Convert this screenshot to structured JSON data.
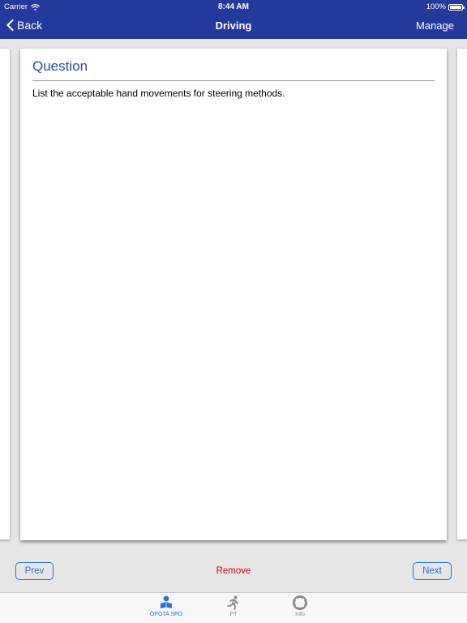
{
  "status_bar": {
    "carrier": "Carrier",
    "time": "8:44 AM",
    "battery": "100%"
  },
  "nav": {
    "back_label": "Back",
    "title": "Driving",
    "manage_label": "Manage"
  },
  "card": {
    "heading": "Question",
    "question_text": "List the acceptable hand movements for steering methods."
  },
  "toolbar": {
    "prev_label": "Prev",
    "remove_label": "Remove",
    "next_label": "Next"
  },
  "tabs": [
    {
      "label": "OPOTA SPO",
      "icon": "reader-icon",
      "active": true
    },
    {
      "label": "PT",
      "icon": "runner-icon",
      "active": false
    },
    {
      "label": "Info",
      "icon": "lifebuoy-icon",
      "active": false
    }
  ],
  "colors": {
    "nav_bar": "#233a9c",
    "heading": "#2e48a8",
    "accent": "#2e6fd8",
    "remove": "#d0021b"
  }
}
